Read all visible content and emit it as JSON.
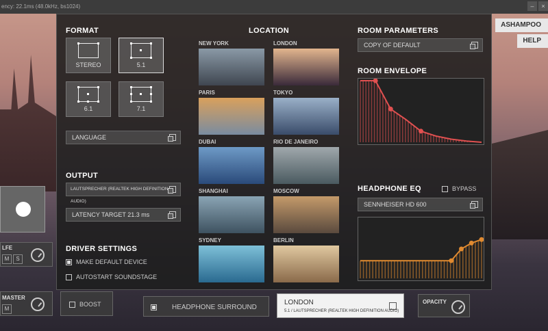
{
  "window": {
    "status_text": "ency: 22.1ms (48.0kHz, bs1024)",
    "close_label": "×",
    "min_label": "–"
  },
  "right_buttons": {
    "ashampoo": "ASHAMPOO",
    "help": "HELP"
  },
  "format": {
    "title": "FORMAT",
    "tiles": [
      {
        "label": "STEREO",
        "selected": false
      },
      {
        "label": "5.1",
        "selected": true
      },
      {
        "label": "6.1",
        "selected": false
      },
      {
        "label": "7.1",
        "selected": false
      }
    ],
    "language_label": "LANGUAGE"
  },
  "output": {
    "title": "OUTPUT",
    "device": "LAUTSPRECHER (REALTEK HIGH DEFINITION AUDIO)",
    "latency": "LATENCY TARGET 21.3 ms"
  },
  "driver": {
    "title": "DRIVER SETTINGS",
    "make_default": {
      "label": "MAKE DEFAULT DEVICE",
      "checked": true
    },
    "autostart": {
      "label": "AUTOSTART SOUNDSTAGE",
      "checked": false
    }
  },
  "location": {
    "title": "LOCATION",
    "items": [
      {
        "name": "NEW YORK",
        "colors": [
          "#8a99a6",
          "#3f4650"
        ]
      },
      {
        "name": "LONDON",
        "colors": [
          "#e2b58e",
          "#3a2a3a"
        ]
      },
      {
        "name": "PARIS",
        "colors": [
          "#d9a05c",
          "#7a8ca0"
        ]
      },
      {
        "name": "TOKYO",
        "colors": [
          "#9ab0c8",
          "#3a4c6a"
        ]
      },
      {
        "name": "DUBAI",
        "colors": [
          "#6e9ac6",
          "#2a4a7a"
        ]
      },
      {
        "name": "RIO DE JANEIRO",
        "colors": [
          "#a0a8ac",
          "#4a5a60"
        ]
      },
      {
        "name": "SHANGHAI",
        "colors": [
          "#8aa4b4",
          "#3e5260"
        ]
      },
      {
        "name": "MOSCOW",
        "colors": [
          "#c49a6a",
          "#5a4a3e"
        ]
      },
      {
        "name": "SYDNEY",
        "colors": [
          "#7ec0d8",
          "#2a6a90"
        ]
      },
      {
        "name": "BERLIN",
        "colors": [
          "#e0c8a0",
          "#8a6a4a"
        ]
      }
    ]
  },
  "room": {
    "title": "ROOM PARAMETERS",
    "preset": "COPY OF DEFAULT",
    "envelope_title": "ROOM ENVELOPE",
    "envelope_color": "#e05050"
  },
  "eq": {
    "title": "HEADPHONE EQ",
    "bypass": {
      "label": "BYPASS",
      "checked": false
    },
    "preset": "SENNHEISER HD 600",
    "color": "#e08a30"
  },
  "bottom": {
    "lfe_label": "LFE",
    "master_label": "MASTER",
    "m_label": "M",
    "s_label": "S",
    "boost": {
      "label": "BOOST",
      "checked": false
    },
    "surround": {
      "label": "HEADPHONE SURROUND",
      "checked": true
    },
    "preset_title": "LONDON",
    "preset_sub": "5.1 / LAUTSPRECHER (REALTEK HIGH DEFINITION AUDIO)",
    "opacity_label": "OPACITY"
  },
  "chart_data": [
    {
      "type": "area",
      "x": [
        0,
        1,
        2,
        3,
        4,
        5,
        6,
        7,
        8
      ],
      "values": [
        1.0,
        1.0,
        0.54,
        0.37,
        0.18,
        0.1,
        0.05,
        0.02,
        0.0
      ],
      "ylim": [
        0,
        1
      ]
    },
    {
      "type": "area",
      "x": [
        0,
        1,
        2,
        3,
        4,
        5,
        6,
        7,
        8,
        9,
        10,
        11,
        12
      ],
      "values": [
        0.3,
        0.3,
        0.3,
        0.3,
        0.3,
        0.3,
        0.3,
        0.3,
        0.3,
        0.3,
        0.5,
        0.6,
        0.66
      ],
      "ylim": [
        0,
        1
      ]
    }
  ]
}
